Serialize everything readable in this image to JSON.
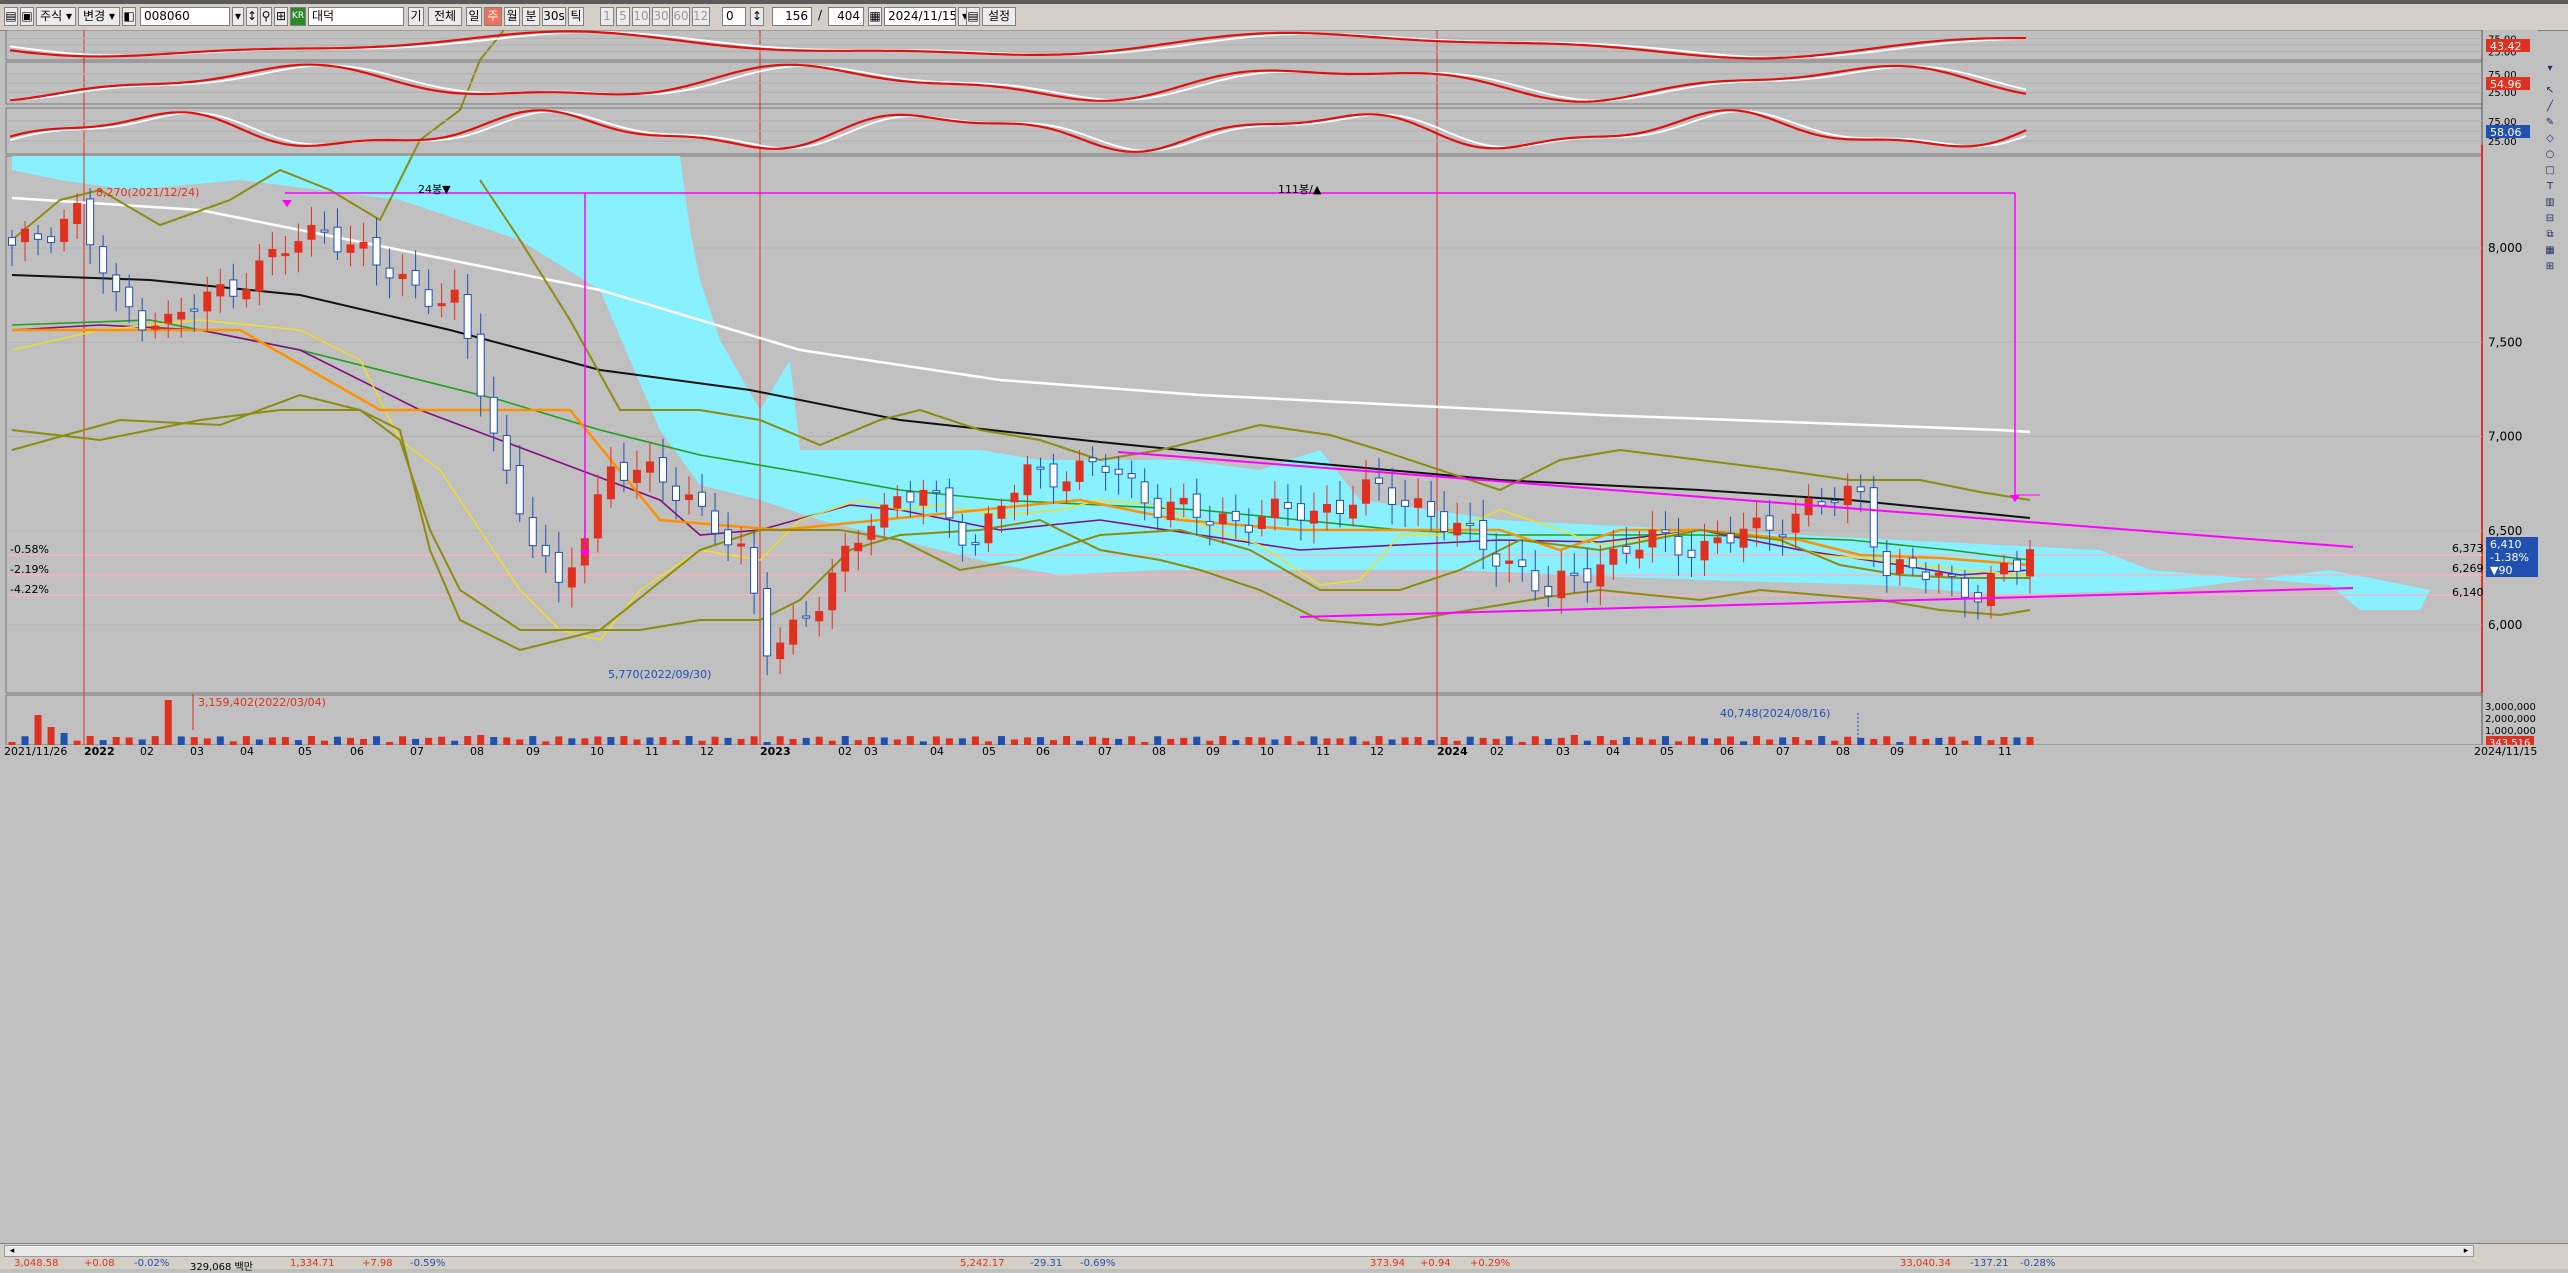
{
  "toolbar": {
    "asset_type": "주식",
    "change_label": "변경",
    "stock_code": "008060",
    "exchange_flag": "KR",
    "stock_name": "대덕",
    "search_label": "기",
    "all_label": "전체",
    "period_day": "일",
    "period_week": "주",
    "period_month": "월",
    "period_minute": "분",
    "period_30min": "30s",
    "period_tick": "틱",
    "count_value": "156",
    "count_sep": "/",
    "count_total": "404",
    "end_date": "2024/11/15",
    "settings_label": "설정"
  },
  "indicators": {
    "panel1": {
      "value": "43.42",
      "levels": [
        "75.00",
        "50",
        "25.00"
      ]
    },
    "panel2": {
      "value": "54.96",
      "levels": [
        "75.00",
        "50",
        "25.00"
      ]
    },
    "panel3": {
      "value": "58.06",
      "levels": [
        "75.00",
        "50",
        "25.00"
      ]
    }
  },
  "price_axis": {
    "ticks": [
      "8,000",
      "7,500",
      "7,000",
      "6,500",
      "6,000"
    ],
    "current_price": "6,410",
    "current_change_pct": "-1.38%",
    "current_change": "▼90",
    "level_tags": [
      "6,373",
      "6,269",
      "6,140"
    ]
  },
  "left_pct_labels": [
    "-0.58%",
    "-2.19%",
    "-4.22%"
  ],
  "annotations": {
    "high_marker": "8,270(2021/12/24)",
    "low_marker": "5,770(2022/09/30)",
    "span1": "24봉▼",
    "span2": "111봉/▲",
    "vol_high": "3,159,402(2022/03/04)",
    "vol_low": "40,748(2024/08/16)"
  },
  "volume_axis": {
    "ticks": [
      "3,000,000",
      "2,000,000",
      "1,000,000"
    ],
    "current": "343,516"
  },
  "date_axis": {
    "start": "2021/11/26",
    "end": "2024/11/15",
    "labels": [
      "2022",
      "02",
      "03",
      "04",
      "05",
      "06",
      "07",
      "08",
      "09",
      "10",
      "11",
      "12",
      "2023",
      "02",
      "03",
      "04",
      "05",
      "06",
      "07",
      "08",
      "09",
      "10",
      "11",
      "12",
      "2024",
      "02",
      "03",
      "04",
      "05",
      "06",
      "07",
      "08",
      "09",
      "10",
      "11"
    ]
  },
  "status_bar": {
    "items": [
      "3,048.58",
      "+0.08",
      "-0.02%",
      "329,068 백만",
      "1,334.71",
      "+7.98",
      "-0.59%",
      "5,242.17",
      "-29.31",
      "-0.69%",
      "373.94",
      "+0.94",
      "+0.29%",
      "33,040.34",
      "-137.21",
      "-0.28%"
    ]
  },
  "colors": {
    "background": "#c0c0c0",
    "up_candle": "#e03020",
    "down_candle": "#2050b0",
    "cloud": "#88f0ff",
    "trendline": "#ff00ff",
    "ma_black": "#111111",
    "ma_white": "#ffffff",
    "ma_green": "#20a020",
    "ma_purple": "#801080",
    "ma_orange": "#ff9000",
    "bollinger": "#8c8c10"
  }
}
